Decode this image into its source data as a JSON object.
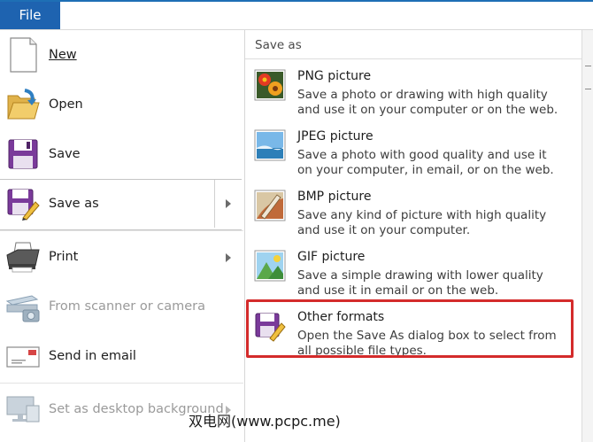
{
  "ribbon": {
    "file_tab": "File"
  },
  "menu": {
    "items": [
      {
        "id": "new",
        "label": "New",
        "icon": "blank-page-icon",
        "disabled": false,
        "submenu": false
      },
      {
        "id": "open",
        "label": "Open",
        "icon": "open-folder-icon",
        "disabled": false,
        "submenu": false
      },
      {
        "id": "save",
        "label": "Save",
        "icon": "floppy-disk-icon",
        "disabled": false,
        "submenu": false
      },
      {
        "id": "save-as",
        "label": "Save as",
        "icon": "save-as-icon",
        "disabled": false,
        "submenu": true,
        "selected": true
      },
      {
        "id": "print",
        "label": "Print",
        "icon": "printer-icon",
        "disabled": false,
        "submenu": true
      },
      {
        "id": "scanner",
        "label": "From scanner or camera",
        "icon": "scanner-camera-icon",
        "disabled": true,
        "submenu": false
      },
      {
        "id": "email",
        "label": "Send in email",
        "icon": "envelope-icon",
        "disabled": false,
        "submenu": false
      },
      {
        "id": "desktop-bg",
        "label": "Set as desktop background",
        "icon": "desktop-monitor-icon",
        "disabled": true,
        "submenu": true
      }
    ]
  },
  "panel": {
    "title": "Save as",
    "options": [
      {
        "id": "png",
        "title": "PNG picture",
        "desc": "Save a photo or drawing with high quality and use it on your computer or on the web.",
        "icon": "png-flower-icon"
      },
      {
        "id": "jpeg",
        "title": "JPEG picture",
        "desc": "Save a photo with good quality and use it on your computer, in email, or on the web.",
        "icon": "jpeg-landscape-icon"
      },
      {
        "id": "bmp",
        "title": "BMP picture",
        "desc": "Save any kind of picture with high quality and use it on your computer.",
        "icon": "bmp-paintbrush-icon"
      },
      {
        "id": "gif",
        "title": "GIF picture",
        "desc": "Save a simple drawing with lower quality and use it in email or on the web.",
        "icon": "gif-shapes-icon"
      },
      {
        "id": "other",
        "title": "Other formats",
        "desc": "Open the Save As dialog box to select from all possible file types.",
        "icon": "other-formats-icon",
        "highlighted": true
      }
    ]
  },
  "watermark": "双电网(www.pcpc.me)",
  "colors": {
    "file_tab": "#1e63b0",
    "highlight": "#d42b2b",
    "accent": "#1e6fb5"
  }
}
